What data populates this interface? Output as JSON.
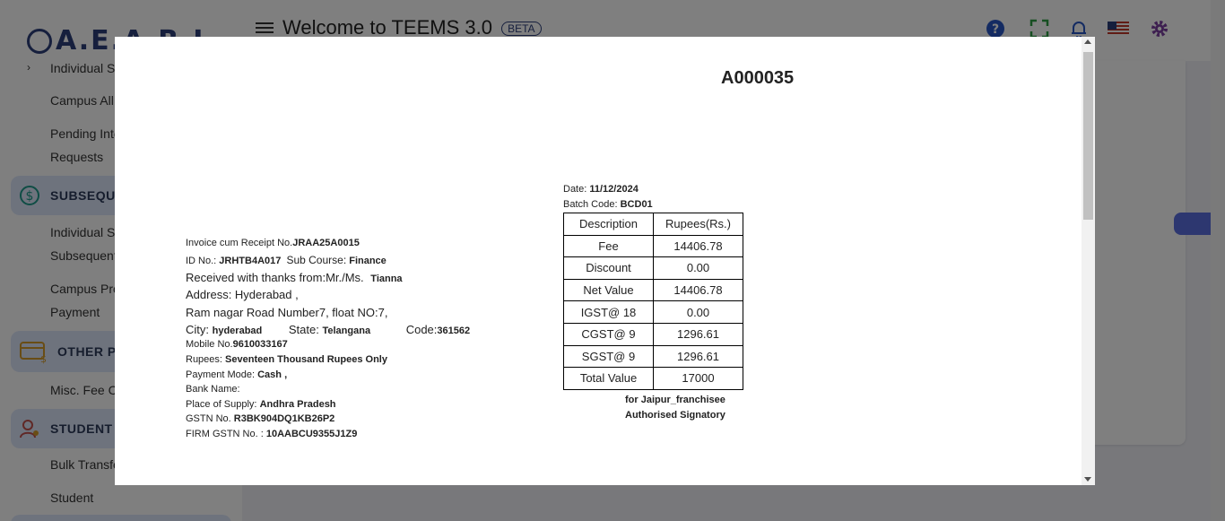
{
  "app": {
    "title": "Welcome to TEEMS 3.0",
    "beta": "BETA",
    "logo_text": "A.E.A.R.I"
  },
  "sidebar": {
    "items": [
      {
        "label": "Individual S"
      },
      {
        "label": "Campus All"
      },
      {
        "label": "Pending Inte"
      },
      {
        "label": "Requests"
      },
      {
        "label": "Individual S"
      },
      {
        "label": "Subsequent"
      },
      {
        "label": "Campus Pro"
      },
      {
        "label": "Payment"
      },
      {
        "label": "Misc. Fee C"
      },
      {
        "label": "Bulk Transfe"
      },
      {
        "label": "Student"
      }
    ],
    "groups": [
      {
        "label": "SUBSEQUEN",
        "icon": "dollar-circle-icon",
        "color": "#1f9a8a"
      },
      {
        "label": "OTHER PA",
        "icon": "card-payment-icon",
        "color": "#d39b2a"
      },
      {
        "label": "STUDENT M",
        "icon": "student-icon",
        "color": "#c0504d"
      }
    ]
  },
  "topbar": {
    "icons": [
      "help-icon",
      "fullscreen-icon",
      "notification-bell-icon",
      "us-flag-icon",
      "settings-gear-icon"
    ]
  },
  "receipt": {
    "number": "A000035",
    "date_label": "Date:",
    "date_value": "11/12/2024",
    "batch_label": "Batch Code:",
    "batch_value": "BCD01",
    "invoice_label": "Invoice cum Receipt No.",
    "invoice_value": "JRAA25A0015",
    "id_label": "ID No.:",
    "id_value": "JRHTB4A017",
    "subcourse_label": "Sub Course:",
    "subcourse_value": "Finance",
    "received_label": "Received with thanks from:Mr./Ms.",
    "received_value": "Tianna",
    "address_line1": "Address: Hyderabad ,",
    "address_line2": "Ram nagar Road Number7, float NO:7,",
    "city_label": "City:",
    "city_value": "hyderabad",
    "state_label": "State:",
    "state_value": "Telangana",
    "code_label": "Code:",
    "code_value": "361562",
    "mobile_label": "Mobile No.",
    "mobile_value": "9610033167",
    "rupees_label": "Rupees:",
    "rupees_value": "Seventeen Thousand Rupees Only",
    "payment_label": "Payment Mode:",
    "payment_value": "Cash ,",
    "bank_label": "Bank Name:",
    "supply_label": "Place of Supply:",
    "supply_value": "Andhra Pradesh",
    "gstn_label": "GSTN No.",
    "gstn_value": "R3BK904DQ1KB26P2",
    "firm_gstn_label": "FIRM GSTN No. :",
    "firm_gstn_value": "10AABCU9355J1Z9",
    "table_headers": [
      "Description",
      "Rupees(Rs.)"
    ],
    "table_rows": [
      [
        "Fee",
        "14406.78"
      ],
      [
        "Discount",
        "0.00"
      ],
      [
        "Net Value",
        "14406.78"
      ],
      [
        "IGST@ 18",
        "0.00"
      ],
      [
        "CGST@ 9",
        "1296.61"
      ],
      [
        "SGST@ 9",
        "1296.61"
      ],
      [
        "Total Value",
        "17000"
      ]
    ],
    "sign_for": "for Jaipur_franchisee",
    "sign_title": "Authorised Signatory"
  }
}
